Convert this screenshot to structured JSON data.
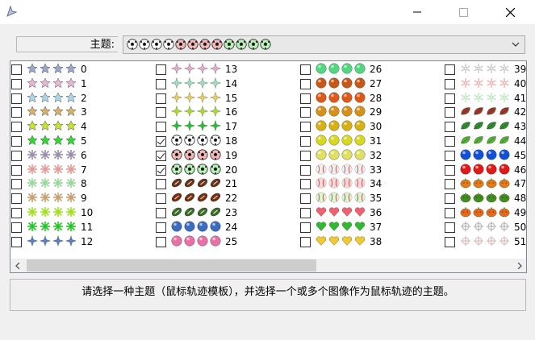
{
  "window": {
    "minimize_icon": "minimize-icon",
    "maximize_icon": "maximize-icon",
    "close_icon": "close-icon",
    "app_icon": "cursor-trail-icon"
  },
  "theme": {
    "label": "主题:",
    "selected_preview": "soccer-balls",
    "dropdown_icon": "chevron-down-icon"
  },
  "columns": [
    {
      "items": [
        {
          "num": "0",
          "kind": "star",
          "color": "#9aa8c8",
          "checked": false
        },
        {
          "num": "1",
          "kind": "star",
          "color": "#e6b8d8",
          "checked": false
        },
        {
          "num": "2",
          "kind": "star",
          "color": "#a8d8e8",
          "checked": false
        },
        {
          "num": "3",
          "kind": "star",
          "color": "#d8b070",
          "checked": false
        },
        {
          "num": "4",
          "kind": "star",
          "color": "#c8e030",
          "checked": false
        },
        {
          "num": "5",
          "kind": "star",
          "color": "#30d830",
          "checked": false
        },
        {
          "num": "6",
          "kind": "spark",
          "color": "#9890a8",
          "checked": false
        },
        {
          "num": "7",
          "kind": "spark",
          "color": "#e89898",
          "checked": false
        },
        {
          "num": "8",
          "kind": "spark",
          "color": "#98d898",
          "checked": false
        },
        {
          "num": "9",
          "kind": "spark",
          "color": "#c8a070",
          "checked": false
        },
        {
          "num": "10",
          "kind": "spark",
          "color": "#a0e020",
          "checked": false
        },
        {
          "num": "11",
          "kind": "spark",
          "color": "#20c820",
          "checked": false
        },
        {
          "num": "12",
          "kind": "diamond",
          "color": "#5080c8",
          "checked": false
        }
      ]
    },
    {
      "items": [
        {
          "num": "13",
          "kind": "diamond",
          "color": "#e8a8d0",
          "checked": false
        },
        {
          "num": "14",
          "kind": "diamond",
          "color": "#98e0c0",
          "checked": false
        },
        {
          "num": "15",
          "kind": "diamond",
          "color": "#e8d060",
          "checked": false
        },
        {
          "num": "16",
          "kind": "diamond",
          "color": "#a8e020",
          "checked": false
        },
        {
          "num": "17",
          "kind": "diamond",
          "color": "#20c030",
          "checked": false
        },
        {
          "num": "18",
          "kind": "soccer",
          "color": "#ffffff",
          "checked": true
        },
        {
          "num": "19",
          "kind": "soccer",
          "color": "#f4b8b8",
          "checked": true
        },
        {
          "num": "20",
          "kind": "soccer",
          "color": "#b8f0b8",
          "checked": true
        },
        {
          "num": "21",
          "kind": "football",
          "color": "#6a3418",
          "checked": false
        },
        {
          "num": "22",
          "kind": "football",
          "color": "#7a2e10",
          "checked": false
        },
        {
          "num": "23",
          "kind": "football",
          "color": "#3a7028",
          "checked": false
        },
        {
          "num": "24",
          "kind": "ball",
          "color": "#3a6cc0",
          "checked": false
        },
        {
          "num": "25",
          "kind": "ball",
          "color": "#e870a8",
          "checked": false
        }
      ]
    },
    {
      "items": [
        {
          "num": "26",
          "kind": "ball",
          "color": "#50d880",
          "checked": false
        },
        {
          "num": "27",
          "kind": "ball",
          "color": "#c85818",
          "checked": false
        },
        {
          "num": "28",
          "kind": "ball",
          "color": "#e05818",
          "checked": false
        },
        {
          "num": "29",
          "kind": "ball",
          "color": "#d89018",
          "checked": false
        },
        {
          "num": "30",
          "kind": "ball",
          "color": "#d8b010",
          "checked": false
        },
        {
          "num": "31",
          "kind": "ball",
          "color": "#d8d820",
          "checked": false
        },
        {
          "num": "32",
          "kind": "ball",
          "color": "#e0e060",
          "checked": false
        },
        {
          "num": "33",
          "kind": "baseball",
          "color": "#f0f0f0",
          "checked": false
        },
        {
          "num": "34",
          "kind": "baseball",
          "color": "#f8d8d8",
          "checked": false
        },
        {
          "num": "35",
          "kind": "baseball",
          "color": "#d8f8d0",
          "checked": false
        },
        {
          "num": "36",
          "kind": "heart",
          "color": "#f06070",
          "checked": false
        },
        {
          "num": "37",
          "kind": "heart",
          "color": "#30b830",
          "checked": false
        },
        {
          "num": "38",
          "kind": "heart",
          "color": "#f0c830",
          "checked": false
        }
      ]
    },
    {
      "items": [
        {
          "num": "39",
          "kind": "snow",
          "color": "#c8c8c8",
          "checked": false
        },
        {
          "num": "40",
          "kind": "snow",
          "color": "#f0b0b0",
          "checked": false
        },
        {
          "num": "41",
          "kind": "snow",
          "color": "#b8e8b8",
          "checked": false
        },
        {
          "num": "42",
          "kind": "leaf",
          "color": "#a03828",
          "checked": false
        },
        {
          "num": "43",
          "kind": "leaf",
          "color": "#309030",
          "checked": false
        },
        {
          "num": "44",
          "kind": "leaf",
          "color": "#50b830",
          "checked": false
        },
        {
          "num": "45",
          "kind": "ball",
          "color": "#1050d8",
          "checked": false
        },
        {
          "num": "46",
          "kind": "ball",
          "color": "#e01818",
          "checked": false
        },
        {
          "num": "47",
          "kind": "pumpkin",
          "color": "#e87818",
          "checked": false
        },
        {
          "num": "48",
          "kind": "pumpkin",
          "color": "#409020",
          "checked": false
        },
        {
          "num": "49",
          "kind": "pumpkin",
          "color": "#e86818",
          "checked": false
        },
        {
          "num": "50",
          "kind": "flake",
          "color": "#b0b0b0",
          "checked": false
        },
        {
          "num": "51",
          "kind": "flake",
          "color": "#d8b8b8",
          "checked": false
        }
      ]
    }
  ],
  "scrollbar": {
    "left_icon": "scroll-left-icon",
    "right_icon": "scroll-right-icon"
  },
  "description": "请选择一种主题（鼠标轨迹模板），并选择一个或多个图像作为鼠标轨迹的主题。"
}
